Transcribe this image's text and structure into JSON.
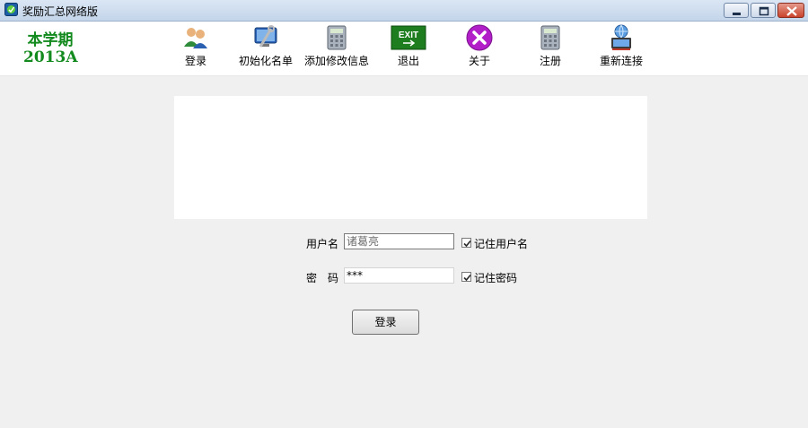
{
  "window": {
    "title": "奖励汇总网络版"
  },
  "header": {
    "term_line1": "本学期",
    "term_line2": "2013A"
  },
  "toolbar": {
    "items": [
      {
        "label": "登录",
        "icon": "users-icon"
      },
      {
        "label": "初始化名单",
        "icon": "monitor-wrench-icon"
      },
      {
        "label": "添加修改信息",
        "icon": "calculator-icon"
      },
      {
        "label": "退出",
        "icon": "exit-sign-icon"
      },
      {
        "label": "关于",
        "icon": "close-circle-icon"
      },
      {
        "label": "注册",
        "icon": "calculator-icon"
      },
      {
        "label": "重新连接",
        "icon": "network-computer-icon"
      }
    ]
  },
  "form": {
    "username_label": "用户名",
    "username_value": "诸葛亮",
    "remember_user_label": "记住用户名",
    "remember_user_checked": true,
    "password_label": "密　码",
    "password_value": "***",
    "remember_password_label": "记住密码",
    "remember_password_checked": true,
    "login_button": "登录"
  },
  "colors": {
    "term_text": "#138a1e",
    "about_icon": "#b21fc9",
    "exit_icon": "#1e7d1e"
  }
}
